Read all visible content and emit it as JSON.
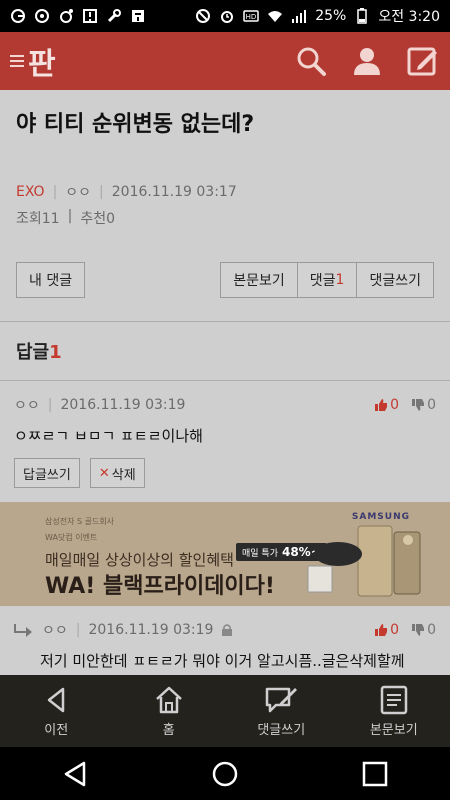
{
  "status_bar": {
    "battery": "25%",
    "time": "오전 3:20",
    "left_icons": [
      "g-icon",
      "circle-dot-icon",
      "badge-icon",
      "alert-icon",
      "wrench-icon",
      "pan-icon"
    ],
    "right_icons": [
      "block-icon",
      "alarm-icon",
      "hd-icon",
      "wifi-icon",
      "signal-icon",
      "battery-icon"
    ]
  },
  "app_bar": {
    "logo": "판",
    "accent": "#b23a32"
  },
  "post": {
    "title": "야 티티 순위변동 없는데?",
    "category": "EXO",
    "author": "ㅇㅇ",
    "datetime": "2016.11.19 03:17",
    "views_label": "조회",
    "views": "11",
    "recommend_label": "추천",
    "recommend": "0"
  },
  "buttons": {
    "my_comments": "내 댓글",
    "view_post": "본문보기",
    "comments": "댓글",
    "comments_count": "1",
    "write_comment": "댓글쓰기"
  },
  "replies": {
    "label": "답글",
    "count": "1"
  },
  "comments": [
    {
      "author": "ㅇㅇ",
      "datetime": "2016.11.19 03:19",
      "body": "ㅇㅉㄹㄱ ㅂㅁㄱ ㅍㅌㄹ이나해",
      "up": "0",
      "down": "0",
      "reply_button": "답글쓰기",
      "delete_button": "삭제"
    },
    {
      "author": "ㅇㅇ",
      "datetime": "2016.11.19 03:19",
      "body": "저기 미안한데 ㅍㅌㄹ가 뭐야 이거 알고시픔..글은삭제할께",
      "up": "0",
      "down": "0"
    }
  ],
  "ad": {
    "brand": "삼성전자 S 골드회사",
    "sub": "WA닷컴 이벤트",
    "line1": "매일매일 상상이상의 할인혜택",
    "line2": "WA! 블랙프라이데이다!",
    "deal_label": "매일 특가",
    "deal_pct": "48%~",
    "samsung": "SAMSUNG"
  },
  "bottom_nav": {
    "prev": "이전",
    "home": "홈",
    "write_comment": "댓글쓰기",
    "view_post": "본문보기"
  }
}
